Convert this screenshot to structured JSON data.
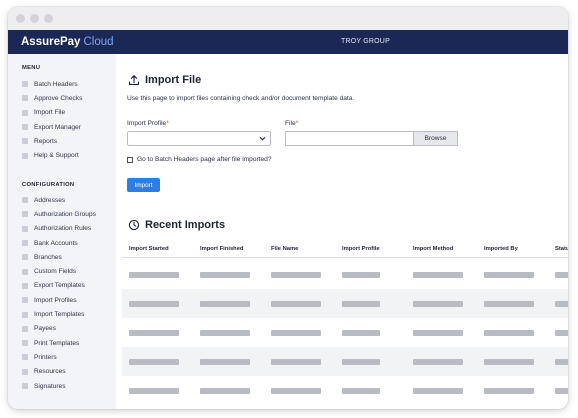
{
  "app": {
    "brand_name": "AssurePay",
    "brand_suffix": "Cloud",
    "organization": "TROY GROUP"
  },
  "sidebar": {
    "menu_heading": "MENU",
    "menu_items": [
      {
        "label": "Batch Headers"
      },
      {
        "label": "Approve Checks"
      },
      {
        "label": "Import File"
      },
      {
        "label": "Export Manager"
      },
      {
        "label": "Reports"
      },
      {
        "label": "Help & Support"
      }
    ],
    "config_heading": "CONFIGURATION",
    "config_items": [
      {
        "label": "Addresses"
      },
      {
        "label": "Authorization Groups"
      },
      {
        "label": "Authorization Rules"
      },
      {
        "label": "Bank Accounts"
      },
      {
        "label": "Branches"
      },
      {
        "label": "Custom Fields"
      },
      {
        "label": "Export Templates"
      },
      {
        "label": "Import Profiles"
      },
      {
        "label": "Import Templates"
      },
      {
        "label": "Payees"
      },
      {
        "label": "Print Templates"
      },
      {
        "label": "Printers"
      },
      {
        "label": "Resources"
      },
      {
        "label": "Signatures"
      }
    ]
  },
  "import_file": {
    "title": "Import File",
    "description": "Use this page to import files containing check and/or document template data.",
    "profile_label": "Import Profile",
    "profile_value": "",
    "file_label": "File",
    "file_value": "",
    "required_mark": "*",
    "browse_label": "Browse",
    "checkbox_label": "Go to Batch Headers page after file imported?",
    "checkbox_checked": false,
    "import_button": "Import"
  },
  "recent_imports": {
    "title": "Recent Imports",
    "columns": [
      "Import Started",
      "Import Finished",
      "File Name",
      "Import Profile",
      "Import Method",
      "Imported By",
      "Status"
    ]
  },
  "colors": {
    "header_bg": "#1b2856",
    "brand_accent": "#7ea9f2",
    "primary_button": "#2f7de1",
    "required": "#d13b3b"
  }
}
